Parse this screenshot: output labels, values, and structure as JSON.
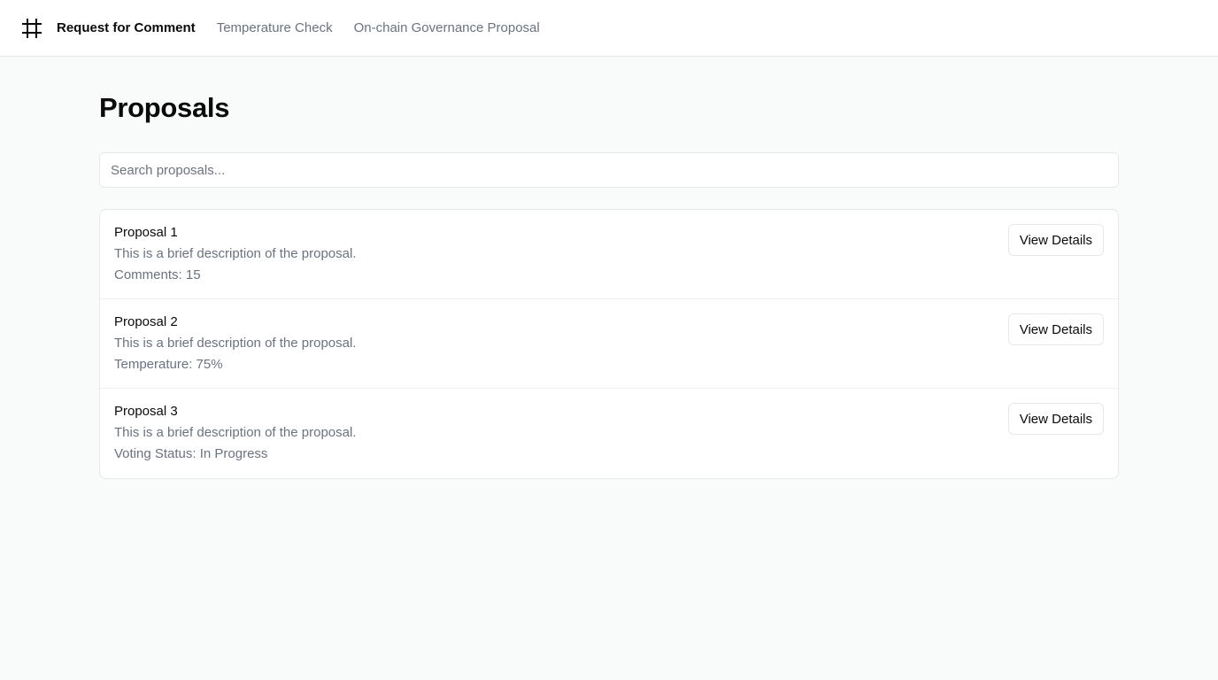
{
  "header": {
    "logo_icon": "hash-icon",
    "nav": [
      {
        "label": "Request for Comment",
        "active": true
      },
      {
        "label": "Temperature Check",
        "active": false
      },
      {
        "label": "On-chain Governance Proposal",
        "active": false
      }
    ]
  },
  "main": {
    "title": "Proposals",
    "search": {
      "placeholder": "Search proposals...",
      "value": ""
    },
    "proposals": [
      {
        "title": "Proposal 1",
        "description": "This is a brief description of the proposal.",
        "meta": "Comments: 15",
        "button": "View Details"
      },
      {
        "title": "Proposal 2",
        "description": "This is a brief description of the proposal.",
        "meta": "Temperature: 75%",
        "button": "View Details"
      },
      {
        "title": "Proposal 3",
        "description": "This is a brief description of the proposal.",
        "meta": "Voting Status: In Progress",
        "button": "View Details"
      }
    ]
  },
  "colors": {
    "background": "#f9fafa",
    "surface": "#ffffff",
    "border": "#e5e7eb",
    "text": "#0a0a0a",
    "muted": "#6b7280"
  }
}
